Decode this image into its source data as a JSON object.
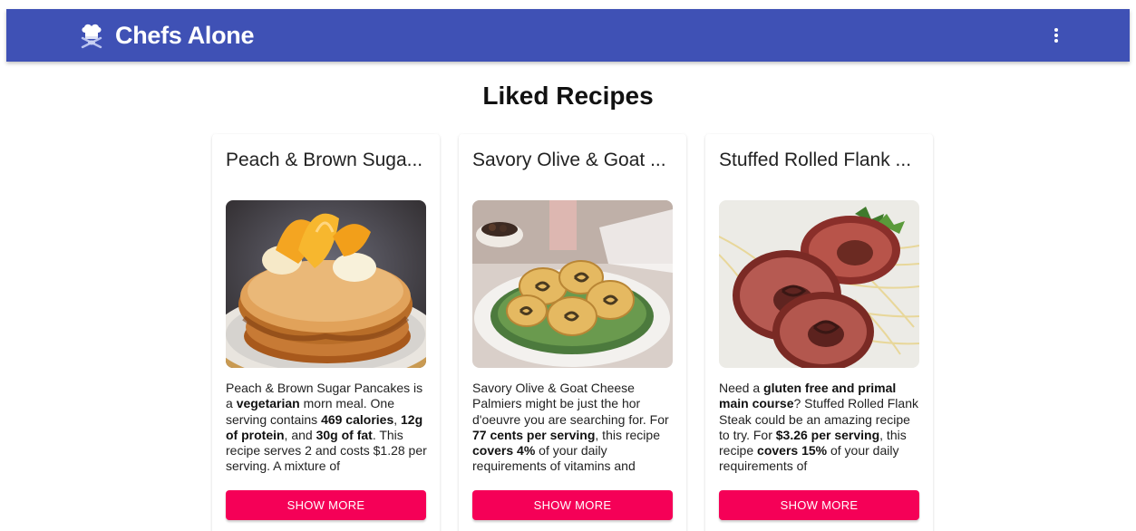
{
  "app": {
    "title": "Chefs Alone",
    "logo_icon": "chef-hat-icon",
    "menu_icon": "more-vert-icon",
    "colors": {
      "appbar": "#3f51b5",
      "button": "#f50057"
    }
  },
  "main": {
    "heading": "Liked Recipes"
  },
  "recipes": [
    {
      "title": "Peach & Brown Suga...",
      "image_alt": "pancakes-with-peaches",
      "summary": [
        {
          "t": "Peach & Brown Sugar Pancakes is a ",
          "b": false
        },
        {
          "t": "vegetarian",
          "b": true
        },
        {
          "t": " morn meal. One serving contains ",
          "b": false
        },
        {
          "t": "469 calories",
          "b": true
        },
        {
          "t": ", ",
          "b": false
        },
        {
          "t": "12g of protein",
          "b": true
        },
        {
          "t": ", and ",
          "b": false
        },
        {
          "t": "30g of fat",
          "b": true
        },
        {
          "t": ". This recipe serves 2 and costs $1.28 per serving. A mixture of",
          "b": false
        }
      ],
      "button_label": "SHOW MORE"
    },
    {
      "title": "Savory Olive & Goat ...",
      "image_alt": "olive-goat-cheese-palmiers",
      "summary": [
        {
          "t": "Savory Olive & Goat Cheese Palmiers might be just the hor d'oeuvre you are searching for. For ",
          "b": false
        },
        {
          "t": "77 cents per serving",
          "b": true
        },
        {
          "t": ", this recipe ",
          "b": false
        },
        {
          "t": "covers 4%",
          "b": true
        },
        {
          "t": " of your daily requirements of vitamins and",
          "b": false
        }
      ],
      "button_label": "SHOW MORE"
    },
    {
      "title": "Stuffed Rolled Flank ...",
      "image_alt": "stuffed-rolled-flank-steak",
      "summary": [
        {
          "t": "Need a ",
          "b": false
        },
        {
          "t": "gluten free and primal main course",
          "b": true
        },
        {
          "t": "? Stuffed Rolled Flank Steak could be an amazing recipe to try. For ",
          "b": false
        },
        {
          "t": "$3.26 per serving",
          "b": true
        },
        {
          "t": ", this recipe ",
          "b": false
        },
        {
          "t": "covers 15%",
          "b": true
        },
        {
          "t": " of your daily requirements of",
          "b": false
        }
      ],
      "button_label": "SHOW MORE"
    }
  ]
}
